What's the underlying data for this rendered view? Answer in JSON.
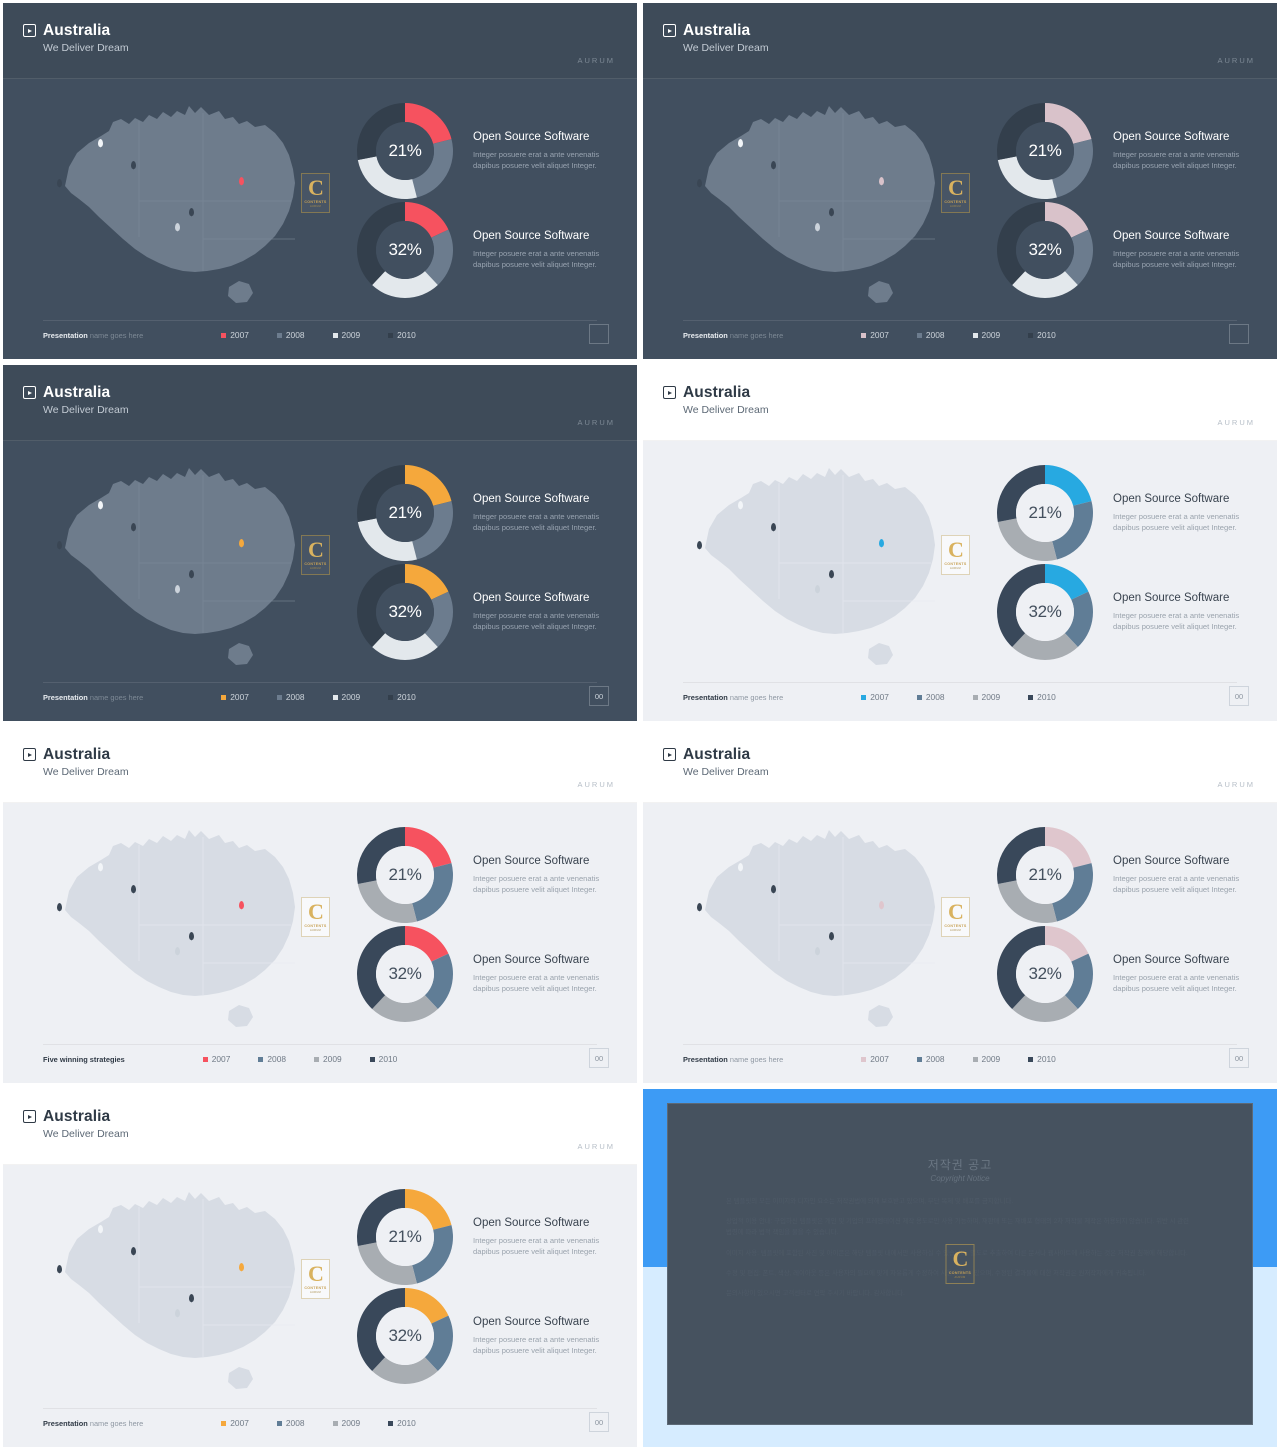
{
  "header": {
    "title": "Australia",
    "subtitle": "We Deliver Dream",
    "brand": "AURUM",
    "play_icon": "play-icon"
  },
  "logo": {
    "letter": "C",
    "line1": "CONTENTS",
    "line2": "AURUM"
  },
  "items": [
    {
      "value": "21%",
      "title": "Open Source Software",
      "desc": "Integer posuere erat a ante venenatis dapibus posuere velit aliquet Integer."
    },
    {
      "value": "32%",
      "title": "Open Source Software",
      "desc": "Integer posuere erat a ante venenatis dapibus posuere velit aliquet Integer."
    }
  ],
  "footer": {
    "name_bold": "Presentation",
    "name_thin": " name goes here",
    "name_alt": "Five winning strategies",
    "page": "00",
    "page_blank": ""
  },
  "legend": {
    "labels": [
      "2007",
      "2008",
      "2009",
      "2010"
    ]
  },
  "copyright": {
    "heading_ko": "저작권 공고",
    "heading_en": "Copyright Notice",
    "paragraphs": [
      "본 템플릿의 모든 이미지와 디자인 요소는 저작권법에 의해 보호받고 있으며, 무단 복제 및 배포를 금지합니다.",
      "상업적 이용 안내: 구입하신 템플릿은 개인 및 기업의 프레젠테이션 제작 용도로만 사용 가능하며, 재판매 또는 재배포 형태의 2차 저작물 제작은 허용되지 않습니다. 위반 시 관련 법령에 따라 법적 책임을 물을 수 있습니다.",
      "이미지 사용: 템플릿에 포함된 사진 및 아이콘은 해당 템플릿 내에서만 사용하실 수 있습니다. 별도로 추출하여 다른 문서나 웹사이트에 사용하는 것은 저작권 침해에 해당합니다.",
      "수정 및 편집: 폰트, 색상, 레이아웃 등은 사용자의 필요에 맞게 자유롭게 수정하여 사용하실 수 있으며, 수정된 결과물에 대한 저작권은 원저작자에게 귀속됩니다.",
      "문의사항이 있으시면 고객센터로 연락 주시기 바랍니다. 감사합니다."
    ]
  },
  "chart_data": [
    {
      "type": "pie",
      "title": "Open Source Software",
      "center_label": "21%",
      "categories": [
        "2007",
        "2008",
        "2009",
        "2010"
      ],
      "values": [
        21,
        25,
        26,
        28
      ],
      "units": "percent"
    },
    {
      "type": "pie",
      "title": "Open Source Software",
      "center_label": "32%",
      "categories": [
        "2007",
        "2008",
        "2009",
        "2010"
      ],
      "values": [
        18,
        20,
        24,
        38
      ],
      "units": "percent"
    }
  ],
  "slides": [
    {
      "theme": "dark",
      "accent": "#f6525f",
      "c2": "#6c7c8e",
      "c3": "#e3e8ec",
      "c4": "#333f4c",
      "footer_variant": "name",
      "page": ""
    },
    {
      "theme": "dark",
      "accent": "#d9c2ca",
      "c2": "#6c7c8e",
      "c3": "#e3e8ec",
      "c4": "#333f4c",
      "footer_variant": "name",
      "page": ""
    },
    {
      "theme": "dark",
      "accent": "#f5a83c",
      "c2": "#6c7c8e",
      "c3": "#e3e8ec",
      "c4": "#333f4c",
      "footer_variant": "name",
      "page": "00"
    },
    {
      "theme": "light",
      "accent": "#27a9e1",
      "c2": "#607d96",
      "c3": "#a8adb2",
      "c4": "#39485a",
      "footer_variant": "name",
      "page": "00"
    },
    {
      "theme": "light",
      "accent": "#f6525f",
      "c2": "#607d96",
      "c3": "#a8adb2",
      "c4": "#39485a",
      "footer_variant": "alt",
      "page": "00"
    },
    {
      "theme": "light",
      "accent": "#dfc6cd",
      "c2": "#607d96",
      "c3": "#a8adb2",
      "c4": "#39485a",
      "footer_variant": "name",
      "page": "00"
    },
    {
      "theme": "light",
      "accent": "#f5a83c",
      "c2": "#607d96",
      "c3": "#a8adb2",
      "c4": "#39485a",
      "footer_variant": "name",
      "page": "00"
    }
  ]
}
